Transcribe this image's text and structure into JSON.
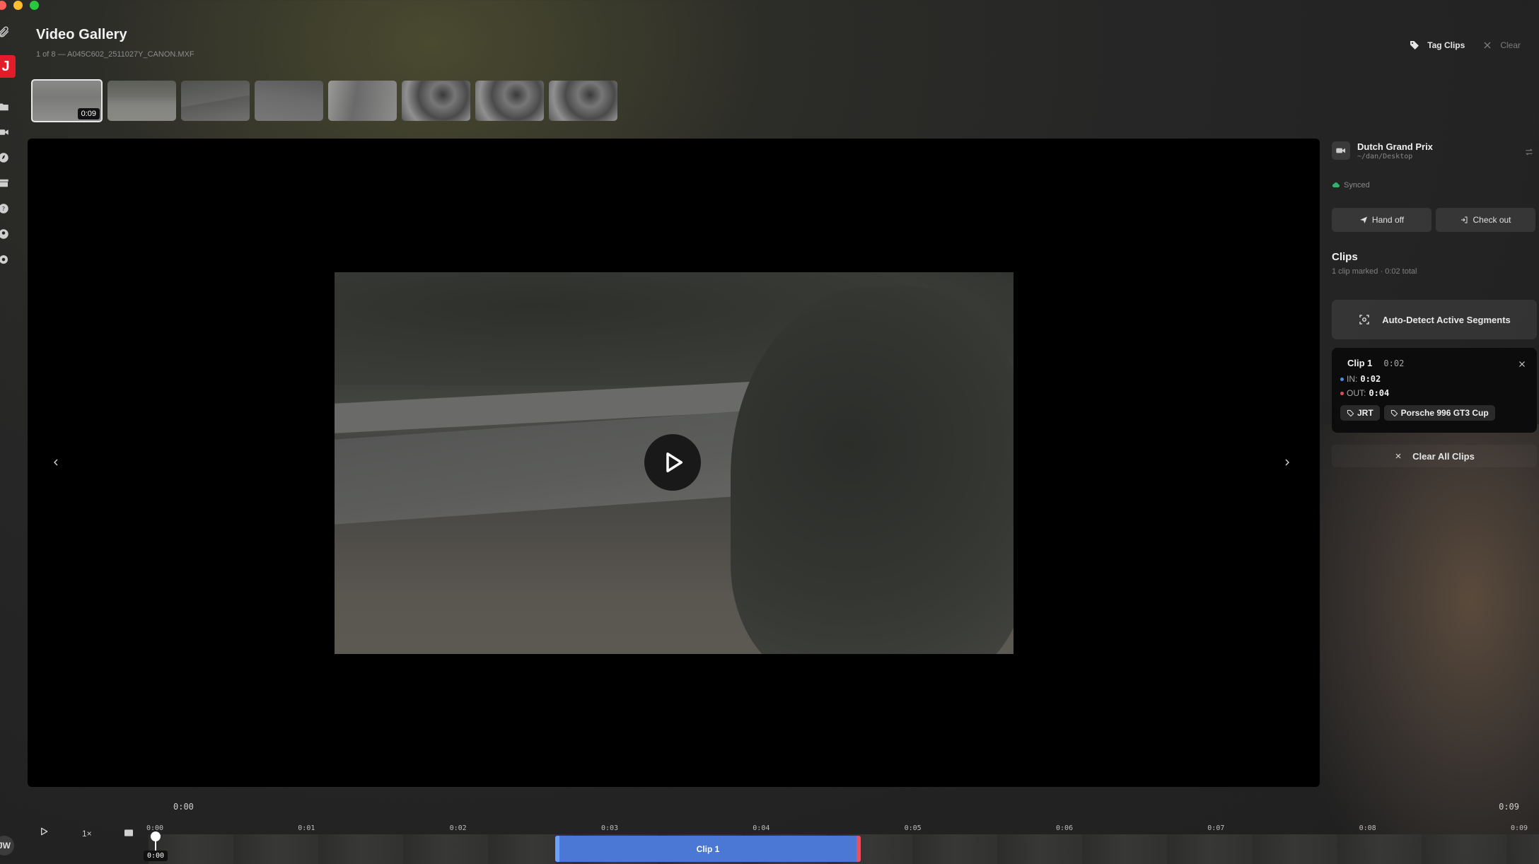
{
  "window": {
    "title": "Video Gallery",
    "subtitle": "1 of 8 — A045C602_2511027Y_CANON.MXF"
  },
  "header": {
    "tag_clips_label": "Tag Clips",
    "clear_label": "Clear"
  },
  "sidebar": {
    "logo_text": "J",
    "avatar_initials": "JW",
    "icons": [
      "paperclip-icon",
      "folder-icon",
      "video-camera-icon",
      "compass-icon",
      "archive-icon",
      "help-icon",
      "users-icon",
      "gear-icon"
    ]
  },
  "thumbnails": [
    {
      "duration": "0:09",
      "active": true
    },
    {
      "active": false
    },
    {
      "active": false
    },
    {
      "active": false
    },
    {
      "active": false
    },
    {
      "active": false
    },
    {
      "active": false
    },
    {
      "active": false
    }
  ],
  "project": {
    "name": "Dutch Grand Prix",
    "path": "~/dan/Desktop",
    "sync_status": "Synced",
    "handoff_label": "Hand off",
    "checkout_label": "Check out"
  },
  "clips_panel": {
    "title": "Clips",
    "summary": "1 clip marked · 0:02 total",
    "auto_detect_label": "Auto-Detect Active Segments",
    "clear_all_label": "Clear All Clips",
    "clips": [
      {
        "name": "Clip 1",
        "duration": "0:02",
        "in_label": "IN:",
        "in_value": "0:02",
        "out_label": "OUT:",
        "out_value": "0:04",
        "tags": [
          "JRT",
          "Porsche 996 GT3 Cup"
        ]
      }
    ]
  },
  "timeline": {
    "start_time": "0:00",
    "end_time": "0:09",
    "speed": "1×",
    "playhead": "0:00",
    "ticks": [
      "0:00",
      "0:01",
      "0:02",
      "0:03",
      "0:04",
      "0:05",
      "0:06",
      "0:07",
      "0:08",
      "0:09"
    ],
    "clip_label": "Clip 1"
  },
  "colors": {
    "in_marker": "#4a8cf0",
    "out_marker": "#e64a5a",
    "clip_bar": "#4a78d4",
    "synced": "#2fb36a",
    "brand": "#e11d2a"
  }
}
